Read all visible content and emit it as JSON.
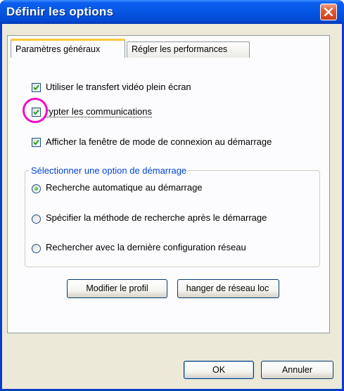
{
  "window": {
    "title": "Définir les options",
    "colors": {
      "titlebar": "#0556e3",
      "close": "#cf3d18",
      "accent": "#ffc83c",
      "group_label": "#0046d5",
      "highlight": "#ec11c8"
    }
  },
  "tabs": [
    {
      "label": "Paramètres généraux",
      "selected": true
    },
    {
      "label": "Régler les performances",
      "selected": false
    }
  ],
  "options": {
    "fullscreen": {
      "label": "Utiliser le transfert vidéo plein écran",
      "checked": true
    },
    "encrypt": {
      "label": "Crypter les communications",
      "label_visible": "rypter les communications",
      "checked": true
    },
    "show_mode_window": {
      "label": "Afficher la fenêtre de mode de connexion au démarrage",
      "checked": true
    }
  },
  "startup_group": {
    "label": "Sélectionner une option de démarrage",
    "radios": [
      {
        "label": "Recherche automatique au démarrage",
        "selected": true
      },
      {
        "label": "Spécifier la méthode de recherche après le démarrage",
        "selected": false
      },
      {
        "label": "Rechercher avec la dernière configuration réseau",
        "selected": false
      }
    ]
  },
  "buttons": {
    "modify_profile": "Modifier le profil",
    "change_network": "hanger de réseau loc",
    "ok": "OK",
    "cancel": "Annuler"
  },
  "icons": {
    "close": "close-icon",
    "check": "check-icon"
  }
}
